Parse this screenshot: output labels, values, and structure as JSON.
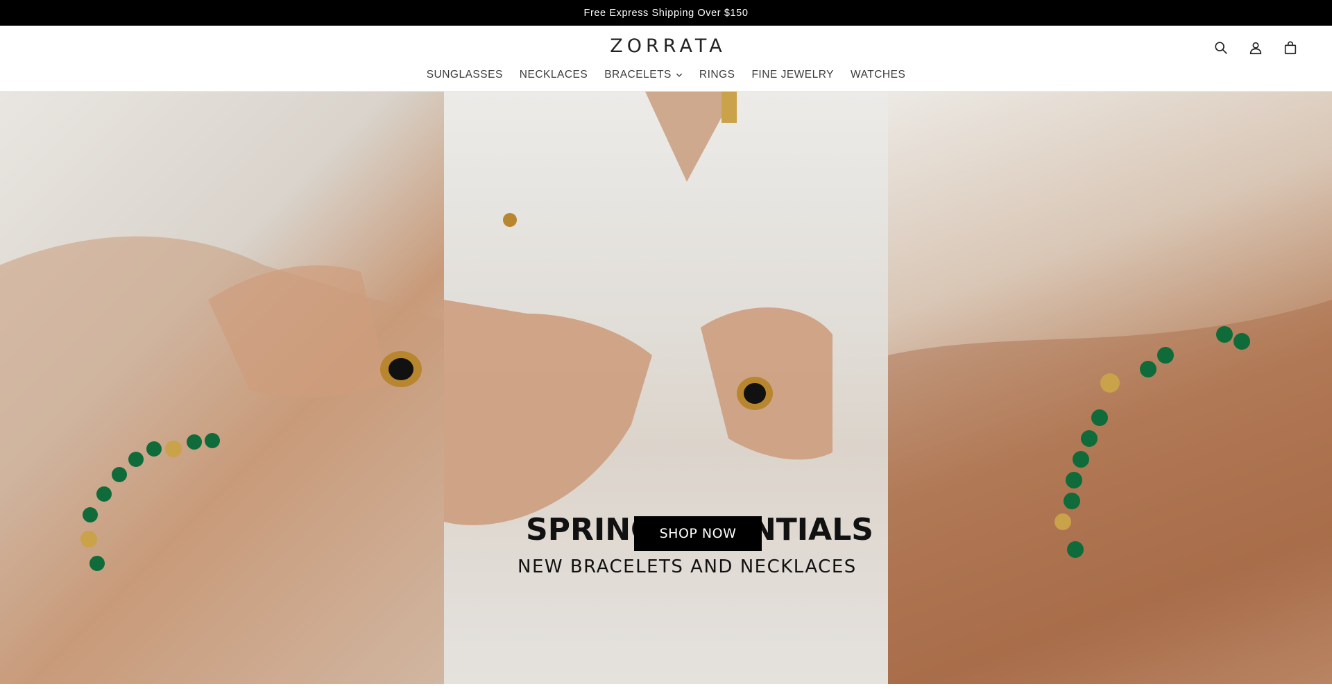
{
  "announcement": {
    "text": "Free Express Shipping Over $150"
  },
  "header": {
    "logo": "ZORRATA",
    "icons": [
      "search-icon",
      "account-icon",
      "cart-icon"
    ]
  },
  "nav": {
    "items": [
      {
        "label": "SUNGLASSES"
      },
      {
        "label": "NECKLACES"
      },
      {
        "label": "BRACELETS",
        "has_dropdown": true
      },
      {
        "label": "RINGS"
      },
      {
        "label": "FINE JEWELRY"
      },
      {
        "label": "WATCHES"
      }
    ]
  },
  "hero": {
    "title": "SPRING ESSENTIALS",
    "subtitle": "NEW BRACELETS AND NECKLACES",
    "cta": "SHOP NOW"
  }
}
